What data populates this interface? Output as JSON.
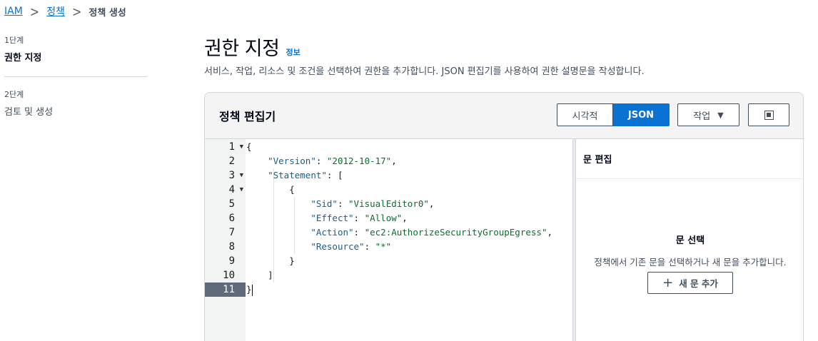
{
  "breadcrumb": {
    "items": [
      "IAM",
      "정책"
    ],
    "separator": ">",
    "current": "정책 생성"
  },
  "steps": [
    {
      "label": "1단계",
      "title": "권한 지정"
    },
    {
      "label": "2단계",
      "title": "검토 및 생성"
    }
  ],
  "header": {
    "title": "권한 지정",
    "info": "정보",
    "description": "서비스, 작업, 리소스 및 조건을 선택하여 권한을 추가합니다. JSON 편집기를 사용하여 권한 설명문을 작성합니다."
  },
  "editor": {
    "title": "정책 편집기",
    "modes": [
      "시각적",
      "JSON"
    ],
    "selected_mode": "JSON",
    "actions_label": "작업",
    "line_numbers": [
      "1",
      "2",
      "3",
      "4",
      "5",
      "6",
      "7",
      "8",
      "9",
      "10",
      "11"
    ],
    "active_line": "11",
    "code": {
      "open_brace": "{",
      "version_key": "\"Version\"",
      "version_value": "\"2012-10-17\"",
      "statement_key": "\"Statement\"",
      "open_bracket": "[",
      "inner_open": "{",
      "sid_key": "\"Sid\"",
      "sid_value": "\"VisualEditor0\"",
      "effect_key": "\"Effect\"",
      "effect_value": "\"Allow\"",
      "action_key": "\"Action\"",
      "action_value": "\"ec2:AuthorizeSecurityGroupEgress\"",
      "resource_key": "\"Resource\"",
      "resource_value": "\"*\"",
      "inner_close": "}",
      "close_bracket": "]",
      "close_brace": "}"
    }
  },
  "side_panel": {
    "title": "문 편집",
    "empty_title": "문 선택",
    "empty_desc": "정책에서 기존 문을 선택하거나 새 문을 추가합니다.",
    "add_label": "새 문 추가"
  }
}
